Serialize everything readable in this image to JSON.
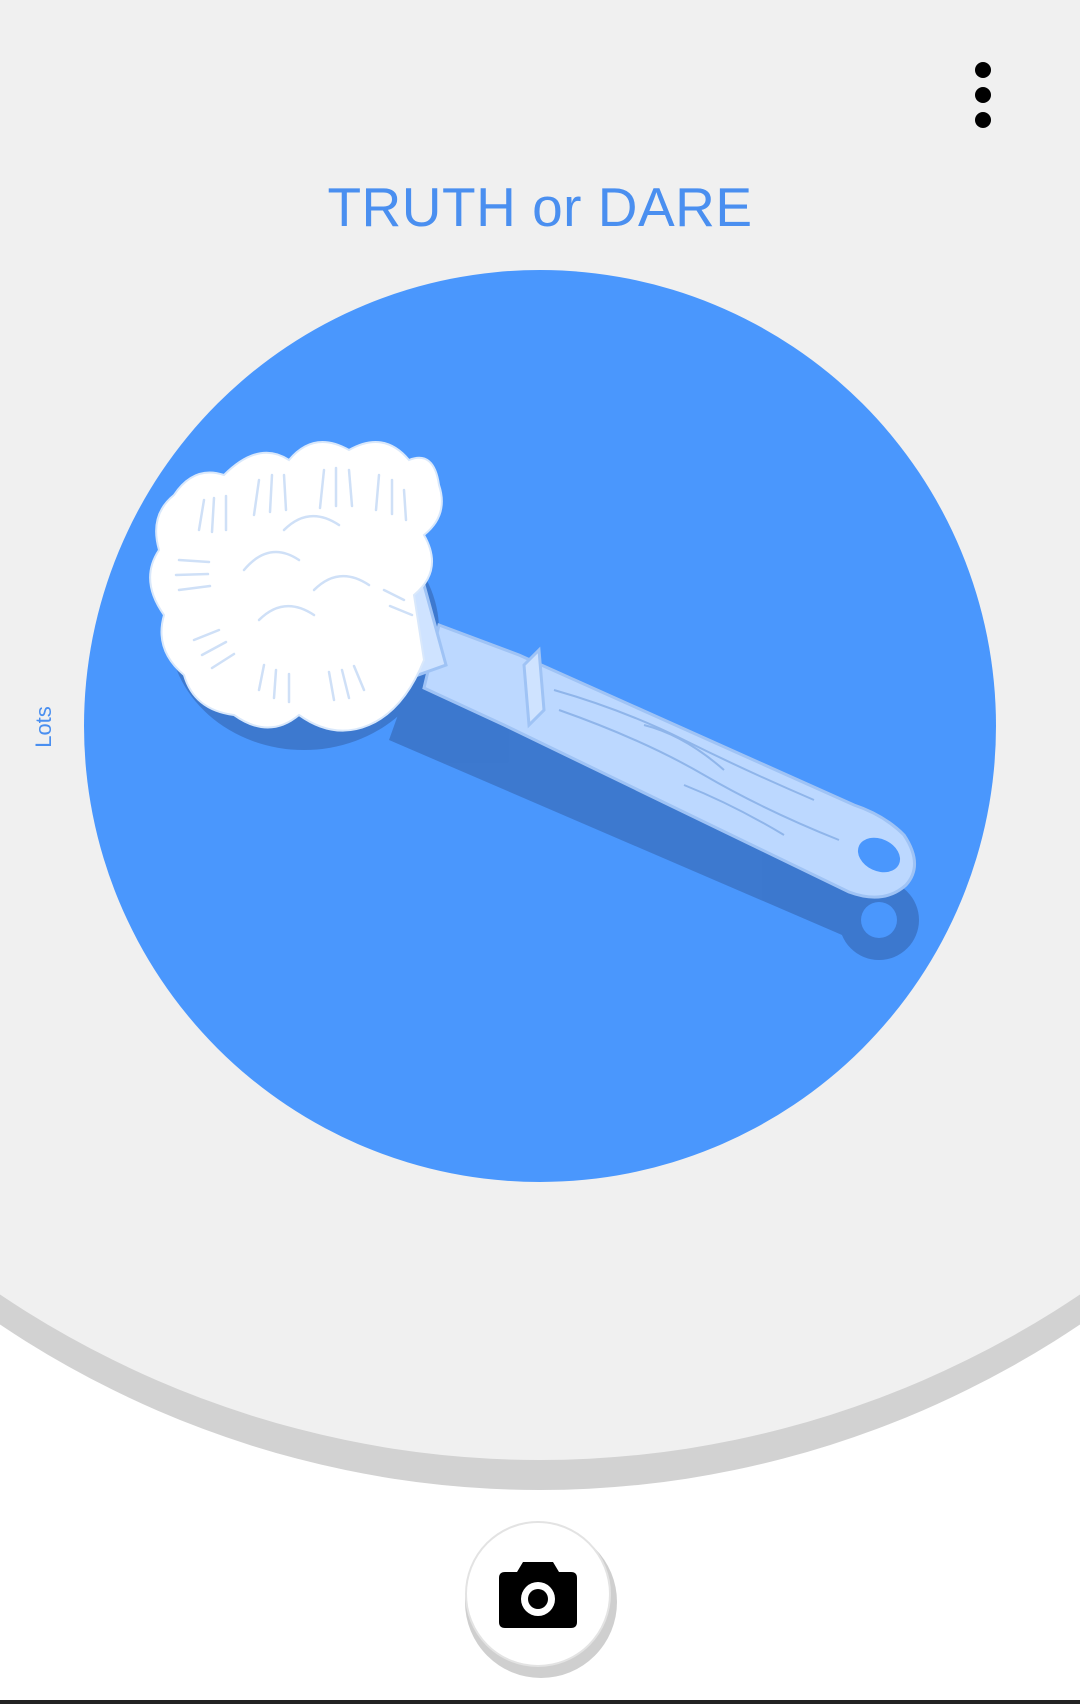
{
  "app": {
    "title": "TRUTH or DARE",
    "side_label": "Lots"
  },
  "toolbar": {
    "menu_icon": "more-vert-icon"
  },
  "wheel": {
    "illustration": "toilet-brush-icon",
    "color": "#4a97fd"
  },
  "footer": {
    "camera_icon": "camera-icon"
  },
  "colors": {
    "accent": "#4a8ff0",
    "panel": "#f0f0f0",
    "panel_shadow": "#d2d2d2",
    "disc": "#4a97fd"
  }
}
